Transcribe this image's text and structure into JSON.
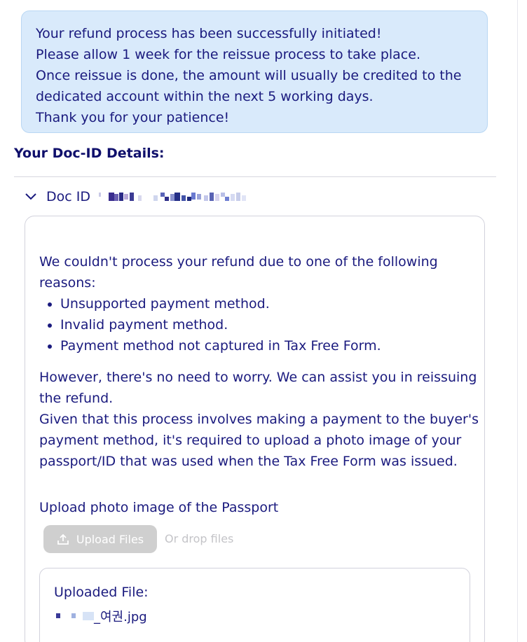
{
  "banner": {
    "lines": [
      "Your refund process has been successfully initiated!",
      "Please allow 1 week for the reissue process to take place.",
      "Once reissue is done, the amount will usually be credited to the",
      "dedicated account within the next 5 working days.",
      "Thank you for your patience!"
    ]
  },
  "details": {
    "title": "Your Doc-ID Details:",
    "accordion_label": "Doc ID",
    "accordion_icon": "chevron-down-icon"
  },
  "card": {
    "intro_lines": [
      "We couldn't process your refund due to one of the following",
      "reasons:"
    ],
    "reasons": [
      "Unsupported payment method.",
      "Invalid payment method.",
      "Payment method not captured in Tax Free Form."
    ],
    "followup_lines": [
      "However, there's no need to worry. We can assist you in reissuing",
      "the refund.",
      "Given that this process involves making a payment to the buyer's",
      "payment method, it's required to upload a photo image of your",
      "passport/ID that was used when the Tax Free Form was issued."
    ],
    "upload_label": "Upload photo image of the Passport",
    "upload_button": "Upload Files",
    "upload_icon": "upload-icon",
    "drop_text": "Or drop files",
    "uploaded_title": "Uploaded File:",
    "uploaded_file_suffix": "_여권.jpg"
  },
  "colors": {
    "text": "#1a1a7e",
    "banner_bg": "#d9eafb",
    "button_disabled": "#cfcfcf"
  }
}
